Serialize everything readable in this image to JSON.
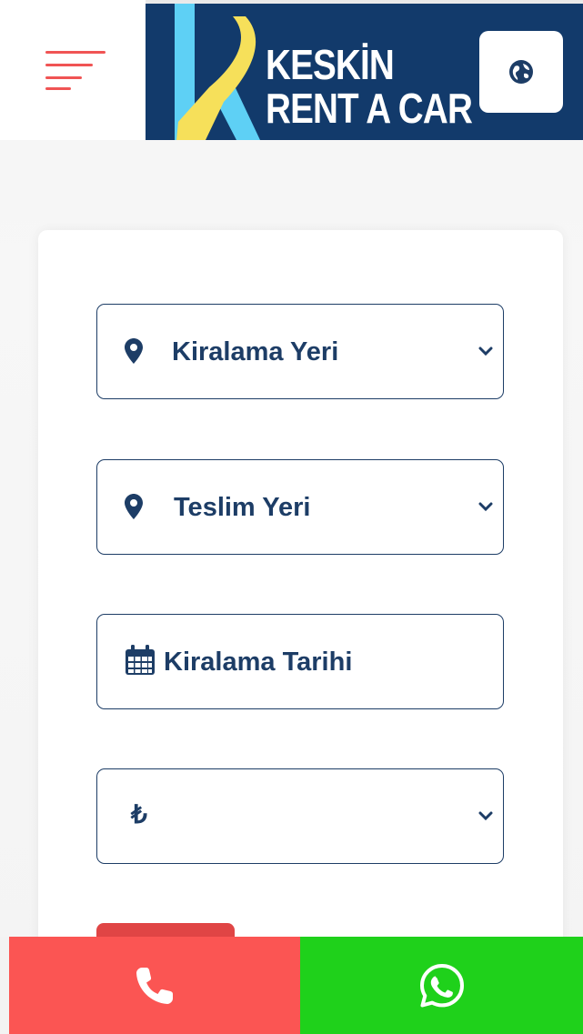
{
  "header": {
    "menu_icon": "hamburger-menu-icon",
    "brand": {
      "line1": "KESKİN",
      "line2": "RENT A CAR",
      "logo_icon": "k-letter-logo",
      "colors": {
        "banner": "#123a6b",
        "blue": "#5ed0f5",
        "yellow": "#f6e05a"
      }
    },
    "language_icon": "globe-icon"
  },
  "form": {
    "pickup_location": {
      "label": "Kiralama Yeri",
      "icon": "map-marker-icon"
    },
    "return_location": {
      "label": "Teslim Yeri",
      "icon": "map-marker-icon"
    },
    "pickup_date": {
      "label": "Kiralama Tarihi",
      "icon": "calendar-icon"
    },
    "currency": {
      "symbol": "₺",
      "icon": "chevron-down-icon"
    }
  },
  "bottom_bar": {
    "call_icon": "phone-icon",
    "whatsapp_icon": "whatsapp-icon",
    "colors": {
      "call": "#fb5553",
      "whatsapp": "#1fd11b"
    }
  },
  "colors": {
    "accent": "#f05454",
    "text": "#1d3d66"
  }
}
